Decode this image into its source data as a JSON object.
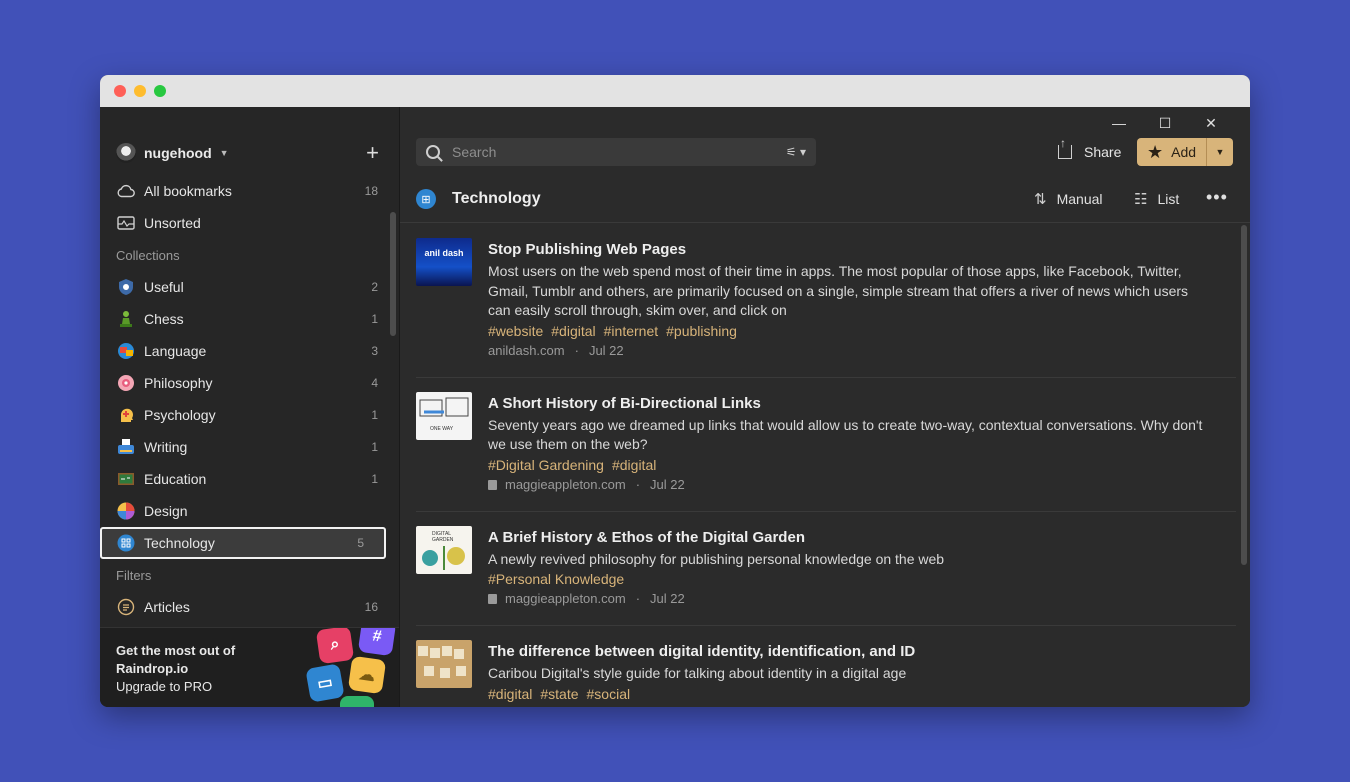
{
  "user": {
    "name": "nugehood"
  },
  "nav": {
    "all": {
      "label": "All bookmarks",
      "count": "18"
    },
    "unsorted": {
      "label": "Unsorted"
    },
    "collections_label": "Collections",
    "collections": [
      {
        "label": "Useful",
        "count": "2",
        "icon": "gear-shield-icon"
      },
      {
        "label": "Chess",
        "count": "1",
        "icon": "chess-pawn-icon"
      },
      {
        "label": "Language",
        "count": "3",
        "icon": "language-icon"
      },
      {
        "label": "Philosophy",
        "count": "4",
        "icon": "brain-flower-icon"
      },
      {
        "label": "Psychology",
        "count": "1",
        "icon": "head-icon"
      },
      {
        "label": "Writing",
        "count": "1",
        "icon": "typewriter-icon"
      },
      {
        "label": "Education",
        "count": "1",
        "icon": "chalkboard-icon"
      },
      {
        "label": "Design",
        "count": "",
        "icon": "color-wheel-icon"
      },
      {
        "label": "Technology",
        "count": "5",
        "icon": "brain-circuit-icon"
      }
    ],
    "filters_label": "Filters",
    "filters": [
      {
        "label": "Articles",
        "count": "16"
      }
    ]
  },
  "promo": {
    "line1": "Get the most out of",
    "line2": "Raindrop.io",
    "line3": "Upgrade to PRO"
  },
  "toolbar": {
    "search_placeholder": "Search",
    "share_label": "Share",
    "add_label": "Add"
  },
  "header": {
    "title": "Technology",
    "sort_label": "Manual",
    "view_label": "List"
  },
  "items": [
    {
      "title": "Stop Publishing Web Pages",
      "desc": "Most users on the web spend most of their time in apps. The most popular of those apps, like Facebook, Twitter, Gmail, Tumblr and others, are primarily focused on a single, simple stream that offers a river of news which users can easily scroll through, skim over, and click on",
      "tags": [
        "#website",
        "#digital",
        "#internet",
        "#publishing"
      ],
      "domain": "anildash.com",
      "date": "Jul 22",
      "thumb_text": "anil dash"
    },
    {
      "title": "A Short History of Bi-Directional Links",
      "desc": "Seventy years ago we dreamed up links that would allow us to create two-way, contextual conversations. Why don't we use them on the web?",
      "tags": [
        "#Digital Gardening",
        "#digital"
      ],
      "domain": "maggieappleton.com",
      "date": "Jul 22"
    },
    {
      "title": "A Brief History & Ethos of the Digital Garden",
      "desc": "A newly revived philosophy for publishing personal knowledge on the web",
      "tags": [
        "#Personal Knowledge"
      ],
      "domain": "maggieappleton.com",
      "date": "Jul 22"
    },
    {
      "title": "The difference between digital identity, identification, and ID",
      "desc": "Caribou Digital's style guide for talking about identity in a digital age",
      "tags": [
        "#digital",
        "#state",
        "#social"
      ],
      "domain": "",
      "date": ""
    }
  ],
  "colors": {
    "accent": "#d8b47a",
    "background": "#4151b8"
  }
}
